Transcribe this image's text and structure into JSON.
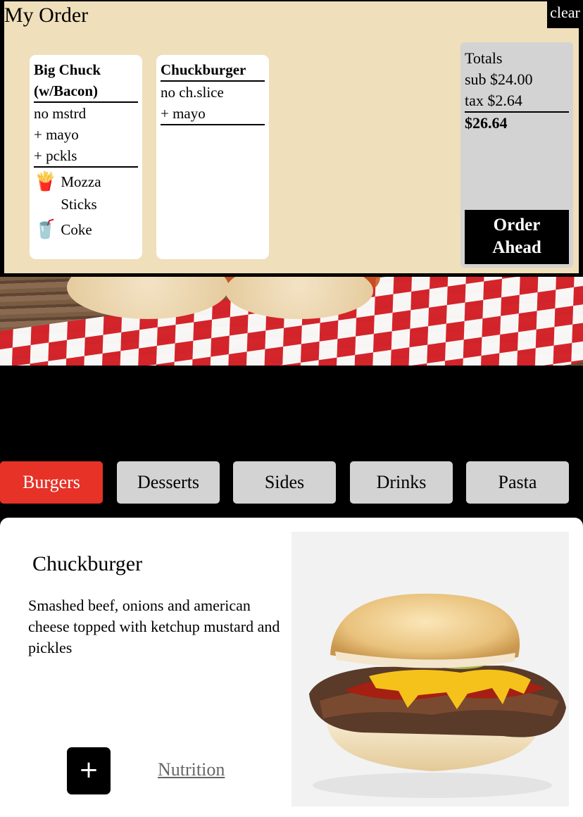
{
  "order": {
    "title": "My Order",
    "clear_label": "clear",
    "tickets": [
      {
        "name": "Big Chuck (w/Bacon)",
        "mods": [
          "no mstrd",
          "+ mayo",
          "+ pckls"
        ],
        "addons": [
          {
            "icon": "fries-icon",
            "glyph": "🍟",
            "label": "Mozza Sticks"
          },
          {
            "icon": "soda-cup-icon",
            "glyph": "🥤",
            "label": "Coke"
          }
        ]
      },
      {
        "name": "Chuckburger",
        "mods": [
          "no ch.slice",
          "+ mayo"
        ],
        "addons": []
      }
    ],
    "totals": {
      "heading": "Totals",
      "sub": "sub $24.00",
      "tax": "tax $2.64",
      "grand": "$26.64"
    },
    "order_ahead_label_line1": "Order",
    "order_ahead_label_line2": "Ahead"
  },
  "tabs": [
    {
      "label": "Burgers",
      "active": true
    },
    {
      "label": "Desserts",
      "active": false
    },
    {
      "label": "Sides",
      "active": false
    },
    {
      "label": "Drinks",
      "active": false
    },
    {
      "label": "Pasta",
      "active": false
    }
  ],
  "item": {
    "title": "Chuckburger",
    "description": "Smashed beef, onions and american cheese topped with ketchup mustard and pickles",
    "add_glyph": "+",
    "nutrition_label": "Nutrition"
  },
  "colors": {
    "panel_bg": "#efdfbb",
    "active_tab": "#e63227",
    "inactive_tab": "#d3d3d3",
    "totals_bg": "#d3d3d3"
  }
}
